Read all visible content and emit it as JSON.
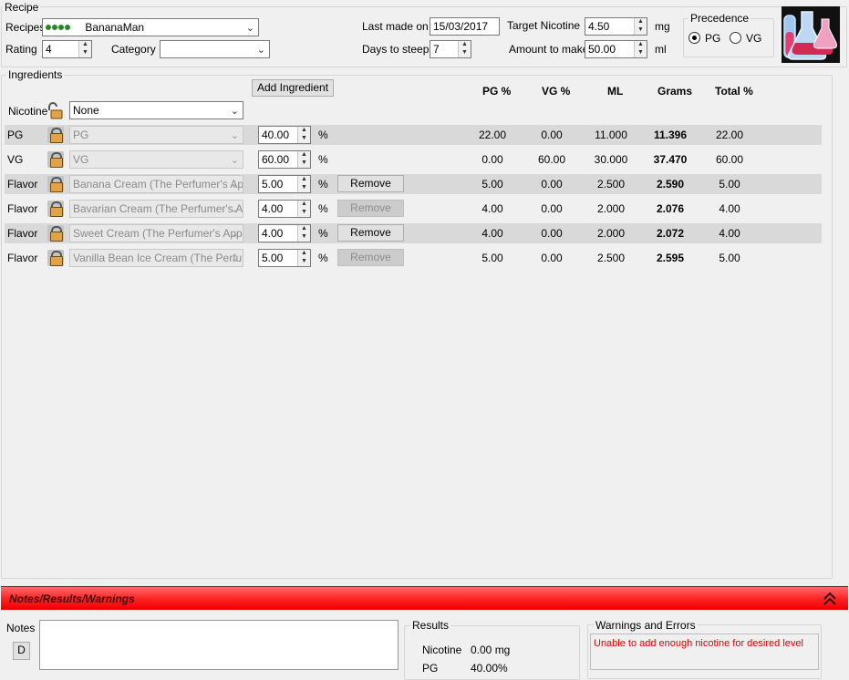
{
  "recipe": {
    "group_title": "Recipe",
    "recipes_label": "Recipes",
    "recipe_name": "BananaMan",
    "rating_label": "Rating",
    "rating_value": "4",
    "category_label": "Category",
    "category_value": "",
    "last_made_label": "Last made on",
    "last_made_value": "15/03/2017",
    "days_steep_label": "Days to steep",
    "days_steep_value": "7",
    "target_nic_label": "Target Nicotine",
    "target_nic_value": "4.50",
    "target_nic_unit": "mg",
    "amount_label": "Amount to make",
    "amount_value": "50.00",
    "amount_unit": "ml",
    "precedence_title": "Precedence",
    "precedence_options": [
      "PG",
      "VG"
    ],
    "precedence_selected": "PG"
  },
  "ingredients": {
    "group_title": "Ingredients",
    "add_button": "Add Ingredient",
    "nicotine_label": "Nicotine",
    "nicotine_value": "None",
    "headers": [
      "PG %",
      "VG %",
      "ML",
      "Grams",
      "Total %"
    ],
    "percent_sign": "%",
    "remove_label": "Remove",
    "rows": [
      {
        "type": "PG",
        "name": "PG",
        "pct": "40.00",
        "pg": "22.00",
        "vg": "0.00",
        "ml": "11.000",
        "grams": "11.396",
        "total": "22.00",
        "removable": false
      },
      {
        "type": "VG",
        "name": "VG",
        "pct": "60.00",
        "pg": "0.00",
        "vg": "60.00",
        "ml": "30.000",
        "grams": "37.470",
        "total": "60.00",
        "removable": false
      },
      {
        "type": "Flavor",
        "name": "Banana Cream (The Perfumer's Apprentice)",
        "pct": "5.00",
        "pg": "5.00",
        "vg": "0.00",
        "ml": "2.500",
        "grams": "2.590",
        "total": "5.00",
        "removable": true
      },
      {
        "type": "Flavor",
        "name": "Bavarian Cream (The Perfumer's Apprentice)",
        "pct": "4.00",
        "pg": "4.00",
        "vg": "0.00",
        "ml": "2.000",
        "grams": "2.076",
        "total": "4.00",
        "removable": false
      },
      {
        "type": "Flavor",
        "name": "Sweet Cream (The Perfumer's Apprentice)",
        "pct": "4.00",
        "pg": "4.00",
        "vg": "0.00",
        "ml": "2.000",
        "grams": "2.072",
        "total": "4.00",
        "removable": true
      },
      {
        "type": "Flavor",
        "name": "Vanilla Bean Ice Cream (The Perfumer's Apprentice)",
        "pct": "5.00",
        "pg": "5.00",
        "vg": "0.00",
        "ml": "2.500",
        "grams": "2.595",
        "total": "5.00",
        "removable": false
      }
    ]
  },
  "notes_panel": {
    "title": "Notes/Results/Warnings",
    "notes_label": "Notes",
    "d_button": "D",
    "notes_text": "",
    "results_title": "Results",
    "results_nic_label": "Nicotine",
    "results_nic_value": "0.00 mg",
    "results_pg_label": "PG",
    "results_pg_value": "40.00%",
    "warnings_title": "Warnings and Errors",
    "warning_text": "Unable to add enough nicotine for desired level"
  },
  "colors": {
    "panel_header": "#ff3030",
    "warning_text": "#e00000",
    "rating_dots": "#1f8c1f"
  }
}
